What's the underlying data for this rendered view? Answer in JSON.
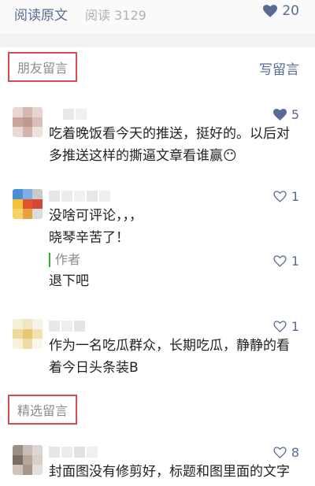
{
  "top_bar": {
    "read_original": "阅读原文",
    "read_count": "阅读 3129",
    "likes": "20"
  },
  "messages_section": {
    "title": "朋友留言",
    "write_comment": "写留言"
  },
  "featured_section": {
    "title": "精选留言"
  },
  "comments": [
    {
      "text": "吃着晚饭看今天的推送，挺好的。以后对多推送这样的撕逼文章看谁赢😶",
      "likes": "5",
      "liked": true
    },
    {
      "text": "没啥可评论，，，\n晓琴辛苦了！",
      "likes": "1",
      "liked": false,
      "reply": {
        "author": "作者",
        "text": "退下吧",
        "likes": "1"
      }
    },
    {
      "text": "作为一名吃瓜群众，长期吃瓜，静静的看着今日头条装B",
      "likes": "1",
      "liked": false
    },
    {
      "text": "封面图没有修剪好，标题和图里面的文字重叠",
      "likes": "8",
      "liked": false
    }
  ],
  "colors": {
    "link_blue": "#576b95",
    "highlight_red": "#d64b4b",
    "author_green": "#38b036",
    "muted_gray": "#8c8c8c"
  },
  "icons": [
    "heart-filled-icon",
    "heart-outline-icon",
    "avatar-pixelated"
  ]
}
